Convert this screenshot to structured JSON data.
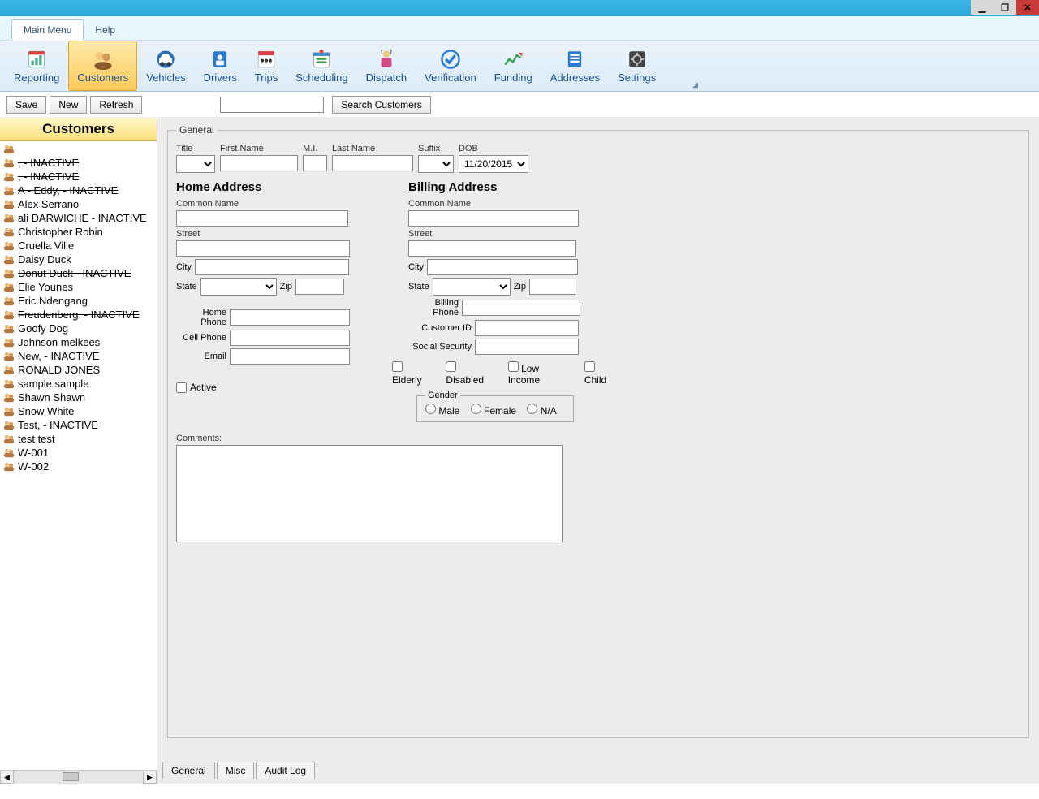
{
  "window": {
    "minimize": "_",
    "maximize": "❐",
    "close": "✕"
  },
  "menu": {
    "main": "Main Menu",
    "help": "Help"
  },
  "ribbon": [
    {
      "key": "reporting",
      "label": "Reporting"
    },
    {
      "key": "customers",
      "label": "Customers",
      "selected": true
    },
    {
      "key": "vehicles",
      "label": "Vehicles"
    },
    {
      "key": "drivers",
      "label": "Drivers"
    },
    {
      "key": "trips",
      "label": "Trips"
    },
    {
      "key": "scheduling",
      "label": "Scheduling"
    },
    {
      "key": "dispatch",
      "label": "Dispatch"
    },
    {
      "key": "verification",
      "label": "Verification"
    },
    {
      "key": "funding",
      "label": "Funding"
    },
    {
      "key": "addresses",
      "label": "Addresses"
    },
    {
      "key": "settings",
      "label": "Settings"
    }
  ],
  "actions": {
    "save": "Save",
    "new": "New",
    "refresh": "Refresh",
    "search": "Search Customers",
    "search_value": ""
  },
  "sidebar": {
    "title": "Customers",
    "items": [
      {
        "label": ", - INACTIVE",
        "inactive": true
      },
      {
        "label": ", - INACTIVE",
        "inactive": true
      },
      {
        "label": "A - Eddy, - INACTIVE",
        "inactive": true
      },
      {
        "label": "Alex Serrano"
      },
      {
        "label": "ali DARWICHE - INACTIVE",
        "inactive": true
      },
      {
        "label": "Christopher Robin"
      },
      {
        "label": "Cruella Ville"
      },
      {
        "label": "Daisy Duck"
      },
      {
        "label": "Donut Duck - INACTIVE",
        "inactive": true
      },
      {
        "label": "Elie  Younes"
      },
      {
        "label": "Eric Ndengang"
      },
      {
        "label": "Freudenberg, - INACTIVE",
        "inactive": true
      },
      {
        "label": "Goofy Dog"
      },
      {
        "label": "Johnson melkees"
      },
      {
        "label": "New, - INACTIVE",
        "inactive": true
      },
      {
        "label": "RONALD JONES"
      },
      {
        "label": "sample sample"
      },
      {
        "label": "Shawn Shawn"
      },
      {
        "label": "Snow White"
      },
      {
        "label": "Test, - INACTIVE",
        "inactive": true
      },
      {
        "label": "test test"
      },
      {
        "label": "W-001"
      },
      {
        "label": "W-002"
      }
    ]
  },
  "form": {
    "legend": "General",
    "labels": {
      "title": "Title",
      "first": "First Name",
      "mi": "M.I.",
      "last": "Last Name",
      "suffix": "Suffix",
      "dob": "DOB",
      "home_hdr": "Home Address",
      "bill_hdr": "Billing Address",
      "common": "Common Name",
      "street": "Street",
      "city": "City",
      "state": "State",
      "zip": "Zip",
      "home_phone": "Home Phone",
      "cell_phone": "Cell Phone",
      "email": "Email",
      "bill_phone": "Billing Phone",
      "cust_id": "Customer ID",
      "ssn": "Social Security",
      "elderly": "Elderly",
      "disabled": "Disabled",
      "low_income": "Low Income",
      "child": "Child",
      "active": "Active",
      "gender_legend": "Gender",
      "male": "Male",
      "female": "Female",
      "na": "N/A",
      "comments": "Comments:"
    },
    "values": {
      "title": "",
      "first": "",
      "mi": "",
      "last": "",
      "suffix": "",
      "dob": "11/20/2015",
      "home": {
        "common": "",
        "street": "",
        "city": "",
        "state": "",
        "zip": "",
        "phone": "",
        "cell": "",
        "email": ""
      },
      "bill": {
        "common": "",
        "street": "",
        "city": "",
        "state": "",
        "zip": "",
        "phone": "",
        "cust_id": "",
        "ssn": ""
      },
      "active": false,
      "elderly": false,
      "disabled": false,
      "low_income": false,
      "child": false,
      "gender": "",
      "comments": ""
    }
  },
  "tabs": {
    "general": "General",
    "misc": "Misc",
    "audit": "Audit Log"
  }
}
